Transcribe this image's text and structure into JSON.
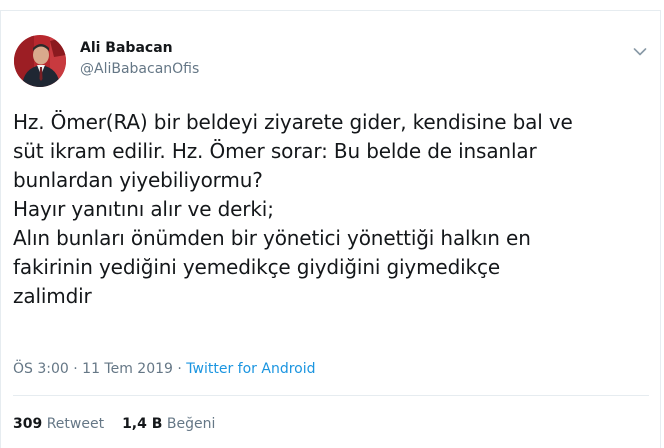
{
  "author": {
    "name": "Ali Babacan",
    "handle": "@AliBabacanOfis"
  },
  "tweet": {
    "text": "Hz. Ömer(RA) bir beldeyi ziyarete gider, kendisine bal ve\nsüt ikram edilir. Hz. Ömer sorar: Bu belde de insanlar\nbunlardan yiyebiliyormu?\nHayır yanıtını alır ve derki;\nAlın bunları önümden bir yönetici yönettiği halkın en\nfakirinin yediğini yemedikçe giydiğini giymedikçe\nzalimdir"
  },
  "meta": {
    "time": "ÖS 3:00",
    "separator1": " · ",
    "date": "11 Tem 2019",
    "separator2": " · ",
    "source": "Twitter for Android"
  },
  "stats": {
    "retweets_count": "309",
    "retweets_label": "Retweet",
    "likes_count": "1,4 B",
    "likes_label": "Beğeni"
  },
  "icons": {
    "caret": "chevron-down-icon",
    "avatar": "avatar"
  },
  "colors": {
    "text": "#14171a",
    "secondary": "#657786",
    "link": "#1b95e0",
    "border": "#e6ecf0"
  }
}
